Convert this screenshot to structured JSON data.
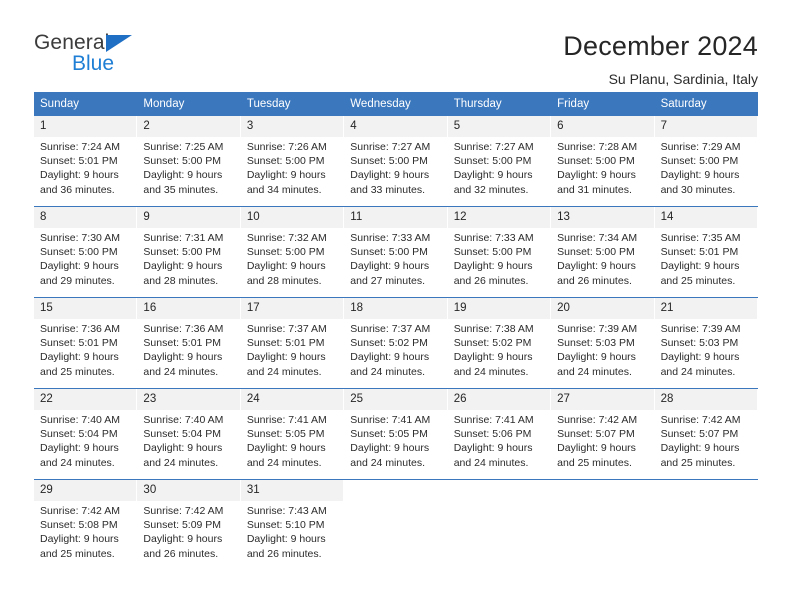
{
  "brand": {
    "name_part1": "General",
    "name_part2": "Blue",
    "triangle_icon": "triangle-icon",
    "colors": {
      "dark": "#3c3c3c",
      "blue": "#1f7fd4",
      "triangle": "#1f6fc4"
    }
  },
  "header": {
    "title": "December 2024",
    "subtitle": "Su Planu, Sardinia, Italy"
  },
  "calendar": {
    "accent_color": "#3b77bd",
    "daynum_band_color": "#f2f2f2",
    "weekdays": [
      "Sunday",
      "Monday",
      "Tuesday",
      "Wednesday",
      "Thursday",
      "Friday",
      "Saturday"
    ],
    "weeks": [
      [
        {
          "day": "1",
          "sunrise": "Sunrise: 7:24 AM",
          "sunset": "Sunset: 5:01 PM",
          "daylight1": "Daylight: 9 hours",
          "daylight2": "and 36 minutes."
        },
        {
          "day": "2",
          "sunrise": "Sunrise: 7:25 AM",
          "sunset": "Sunset: 5:00 PM",
          "daylight1": "Daylight: 9 hours",
          "daylight2": "and 35 minutes."
        },
        {
          "day": "3",
          "sunrise": "Sunrise: 7:26 AM",
          "sunset": "Sunset: 5:00 PM",
          "daylight1": "Daylight: 9 hours",
          "daylight2": "and 34 minutes."
        },
        {
          "day": "4",
          "sunrise": "Sunrise: 7:27 AM",
          "sunset": "Sunset: 5:00 PM",
          "daylight1": "Daylight: 9 hours",
          "daylight2": "and 33 minutes."
        },
        {
          "day": "5",
          "sunrise": "Sunrise: 7:27 AM",
          "sunset": "Sunset: 5:00 PM",
          "daylight1": "Daylight: 9 hours",
          "daylight2": "and 32 minutes."
        },
        {
          "day": "6",
          "sunrise": "Sunrise: 7:28 AM",
          "sunset": "Sunset: 5:00 PM",
          "daylight1": "Daylight: 9 hours",
          "daylight2": "and 31 minutes."
        },
        {
          "day": "7",
          "sunrise": "Sunrise: 7:29 AM",
          "sunset": "Sunset: 5:00 PM",
          "daylight1": "Daylight: 9 hours",
          "daylight2": "and 30 minutes."
        }
      ],
      [
        {
          "day": "8",
          "sunrise": "Sunrise: 7:30 AM",
          "sunset": "Sunset: 5:00 PM",
          "daylight1": "Daylight: 9 hours",
          "daylight2": "and 29 minutes."
        },
        {
          "day": "9",
          "sunrise": "Sunrise: 7:31 AM",
          "sunset": "Sunset: 5:00 PM",
          "daylight1": "Daylight: 9 hours",
          "daylight2": "and 28 minutes."
        },
        {
          "day": "10",
          "sunrise": "Sunrise: 7:32 AM",
          "sunset": "Sunset: 5:00 PM",
          "daylight1": "Daylight: 9 hours",
          "daylight2": "and 28 minutes."
        },
        {
          "day": "11",
          "sunrise": "Sunrise: 7:33 AM",
          "sunset": "Sunset: 5:00 PM",
          "daylight1": "Daylight: 9 hours",
          "daylight2": "and 27 minutes."
        },
        {
          "day": "12",
          "sunrise": "Sunrise: 7:33 AM",
          "sunset": "Sunset: 5:00 PM",
          "daylight1": "Daylight: 9 hours",
          "daylight2": "and 26 minutes."
        },
        {
          "day": "13",
          "sunrise": "Sunrise: 7:34 AM",
          "sunset": "Sunset: 5:00 PM",
          "daylight1": "Daylight: 9 hours",
          "daylight2": "and 26 minutes."
        },
        {
          "day": "14",
          "sunrise": "Sunrise: 7:35 AM",
          "sunset": "Sunset: 5:01 PM",
          "daylight1": "Daylight: 9 hours",
          "daylight2": "and 25 minutes."
        }
      ],
      [
        {
          "day": "15",
          "sunrise": "Sunrise: 7:36 AM",
          "sunset": "Sunset: 5:01 PM",
          "daylight1": "Daylight: 9 hours",
          "daylight2": "and 25 minutes."
        },
        {
          "day": "16",
          "sunrise": "Sunrise: 7:36 AM",
          "sunset": "Sunset: 5:01 PM",
          "daylight1": "Daylight: 9 hours",
          "daylight2": "and 24 minutes."
        },
        {
          "day": "17",
          "sunrise": "Sunrise: 7:37 AM",
          "sunset": "Sunset: 5:01 PM",
          "daylight1": "Daylight: 9 hours",
          "daylight2": "and 24 minutes."
        },
        {
          "day": "18",
          "sunrise": "Sunrise: 7:37 AM",
          "sunset": "Sunset: 5:02 PM",
          "daylight1": "Daylight: 9 hours",
          "daylight2": "and 24 minutes."
        },
        {
          "day": "19",
          "sunrise": "Sunrise: 7:38 AM",
          "sunset": "Sunset: 5:02 PM",
          "daylight1": "Daylight: 9 hours",
          "daylight2": "and 24 minutes."
        },
        {
          "day": "20",
          "sunrise": "Sunrise: 7:39 AM",
          "sunset": "Sunset: 5:03 PM",
          "daylight1": "Daylight: 9 hours",
          "daylight2": "and 24 minutes."
        },
        {
          "day": "21",
          "sunrise": "Sunrise: 7:39 AM",
          "sunset": "Sunset: 5:03 PM",
          "daylight1": "Daylight: 9 hours",
          "daylight2": "and 24 minutes."
        }
      ],
      [
        {
          "day": "22",
          "sunrise": "Sunrise: 7:40 AM",
          "sunset": "Sunset: 5:04 PM",
          "daylight1": "Daylight: 9 hours",
          "daylight2": "and 24 minutes."
        },
        {
          "day": "23",
          "sunrise": "Sunrise: 7:40 AM",
          "sunset": "Sunset: 5:04 PM",
          "daylight1": "Daylight: 9 hours",
          "daylight2": "and 24 minutes."
        },
        {
          "day": "24",
          "sunrise": "Sunrise: 7:41 AM",
          "sunset": "Sunset: 5:05 PM",
          "daylight1": "Daylight: 9 hours",
          "daylight2": "and 24 minutes."
        },
        {
          "day": "25",
          "sunrise": "Sunrise: 7:41 AM",
          "sunset": "Sunset: 5:05 PM",
          "daylight1": "Daylight: 9 hours",
          "daylight2": "and 24 minutes."
        },
        {
          "day": "26",
          "sunrise": "Sunrise: 7:41 AM",
          "sunset": "Sunset: 5:06 PM",
          "daylight1": "Daylight: 9 hours",
          "daylight2": "and 24 minutes."
        },
        {
          "day": "27",
          "sunrise": "Sunrise: 7:42 AM",
          "sunset": "Sunset: 5:07 PM",
          "daylight1": "Daylight: 9 hours",
          "daylight2": "and 25 minutes."
        },
        {
          "day": "28",
          "sunrise": "Sunrise: 7:42 AM",
          "sunset": "Sunset: 5:07 PM",
          "daylight1": "Daylight: 9 hours",
          "daylight2": "and 25 minutes."
        }
      ],
      [
        {
          "day": "29",
          "sunrise": "Sunrise: 7:42 AM",
          "sunset": "Sunset: 5:08 PM",
          "daylight1": "Daylight: 9 hours",
          "daylight2": "and 25 minutes."
        },
        {
          "day": "30",
          "sunrise": "Sunrise: 7:42 AM",
          "sunset": "Sunset: 5:09 PM",
          "daylight1": "Daylight: 9 hours",
          "daylight2": "and 26 minutes."
        },
        {
          "day": "31",
          "sunrise": "Sunrise: 7:43 AM",
          "sunset": "Sunset: 5:10 PM",
          "daylight1": "Daylight: 9 hours",
          "daylight2": "and 26 minutes."
        },
        {
          "day": "",
          "sunrise": "",
          "sunset": "",
          "daylight1": "",
          "daylight2": ""
        },
        {
          "day": "",
          "sunrise": "",
          "sunset": "",
          "daylight1": "",
          "daylight2": ""
        },
        {
          "day": "",
          "sunrise": "",
          "sunset": "",
          "daylight1": "",
          "daylight2": ""
        },
        {
          "day": "",
          "sunrise": "",
          "sunset": "",
          "daylight1": "",
          "daylight2": ""
        }
      ]
    ]
  }
}
